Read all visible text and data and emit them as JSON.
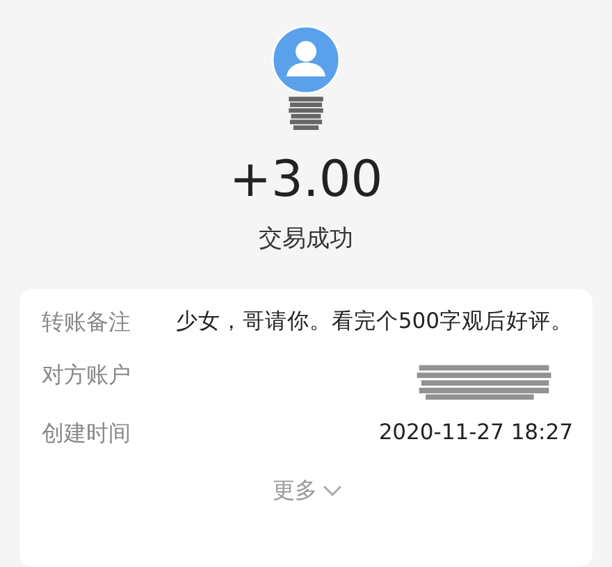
{
  "amount": "+3.00",
  "status": "交易成功",
  "details": [
    {
      "label": "转账备注",
      "value": "少女，哥请你。看完个500字观后好评。",
      "kind": "text"
    },
    {
      "label": "对方账户",
      "kind": "redacted"
    },
    {
      "label": "创建时间",
      "value": "2020-11-27 18:27",
      "kind": "text"
    }
  ],
  "more": "更多"
}
